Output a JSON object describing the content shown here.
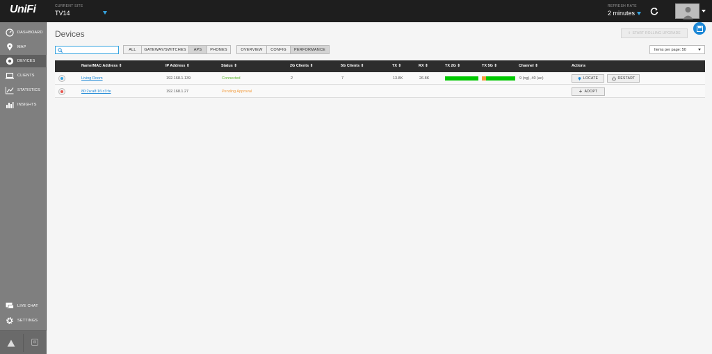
{
  "header": {
    "logo": "UniFi",
    "current_site_label": "CURRENT SITE",
    "current_site": "TV14",
    "refresh_rate_label": "REFRESH RATE",
    "refresh_rate": "2 minutes"
  },
  "sidebar": {
    "items": [
      {
        "label": "DASHBOARD",
        "icon": "dashboard-icon"
      },
      {
        "label": "MAP",
        "icon": "map-pin-icon"
      },
      {
        "label": "DEVICES",
        "icon": "devices-icon"
      },
      {
        "label": "CLIENTS",
        "icon": "clients-icon"
      },
      {
        "label": "STATISTICS",
        "icon": "statistics-icon"
      },
      {
        "label": "INSIGHTS",
        "icon": "insights-icon"
      },
      {
        "label": "LIVE CHAT",
        "icon": "chat-icon"
      },
      {
        "label": "SETTINGS",
        "icon": "gear-icon"
      }
    ],
    "active": "DEVICES"
  },
  "main": {
    "title": "Devices",
    "rolling_upgrade_label": "START ROLLING UPGRADE",
    "search": {
      "value": "",
      "placeholder": ""
    },
    "filter_buttons": [
      "ALL",
      "GATEWAY/SWITCHES",
      "APS",
      "PHONES"
    ],
    "filter_active": "APS",
    "view_buttons": [
      "OVERVIEW",
      "CONFIG",
      "PERFORMANCE"
    ],
    "view_active": "PERFORMANCE",
    "items_per_page": "Items per page: 50"
  },
  "table": {
    "columns": [
      "Name/MAC Address",
      "IP Address",
      "Status",
      "2G Clients",
      "5G Clients",
      "TX",
      "RX",
      "TX 2G",
      "TX 5G",
      "Channel",
      "Actions"
    ],
    "rows": [
      {
        "name": "Living Room",
        "ip": "192.168.1.139",
        "status": "Connected",
        "clients_2g": "2",
        "clients_5g": "7",
        "tx": "13.8K",
        "rx": "26.8K",
        "tx2g_util": 1.0,
        "tx5g_util": 0.12,
        "channel": "9 (ng), 40 (ac)",
        "actions": [
          "LOCATE",
          "RESTART"
        ]
      },
      {
        "name": "80:2a:a8:16:c3:fe",
        "ip": "192.168.1.27",
        "status": "Pending Approval",
        "clients_2g": "",
        "clients_5g": "",
        "tx": "",
        "rx": "",
        "channel": "",
        "actions": [
          "ADOPT"
        ]
      }
    ]
  },
  "colors": {
    "accent": "#36a4e0",
    "connected": "#5bb52c",
    "pending": "#f29a3b",
    "bar_green": "#00c800",
    "bar_orange": "#f29a3b"
  }
}
